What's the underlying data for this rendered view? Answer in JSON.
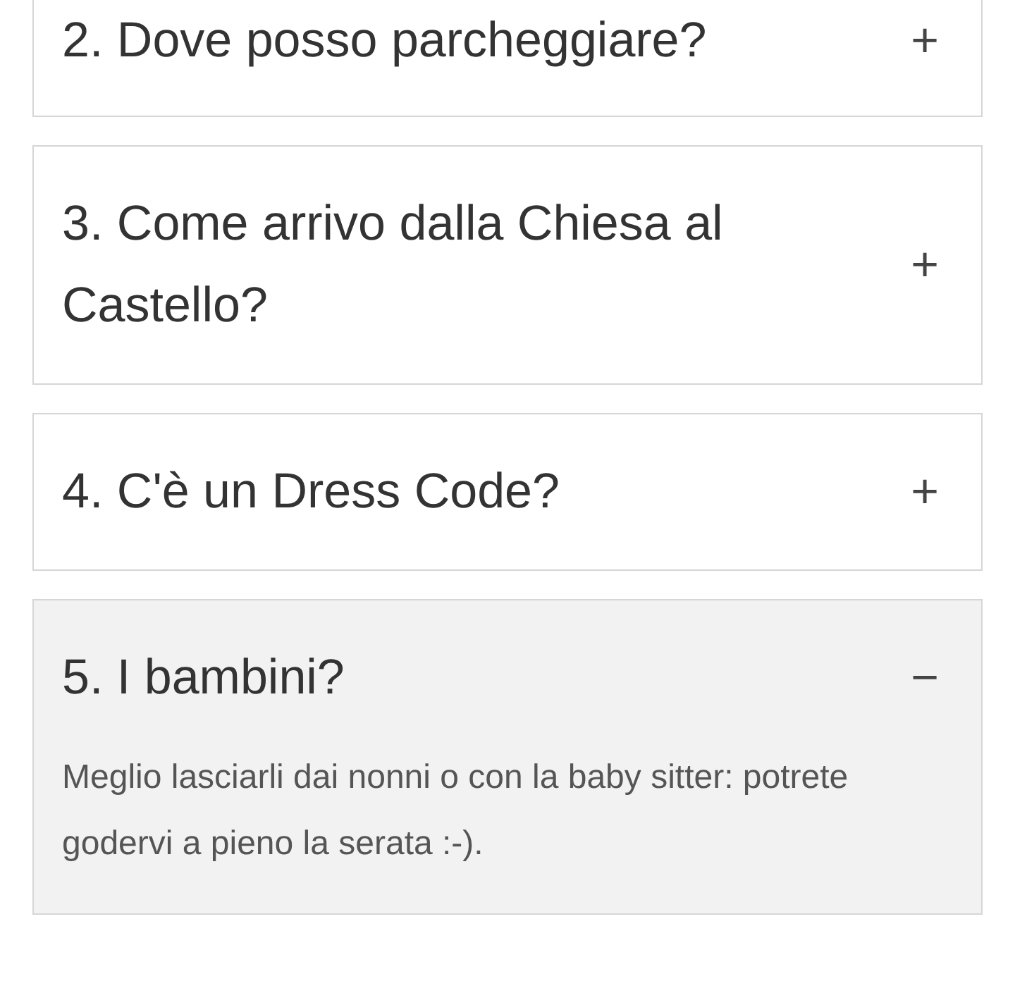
{
  "faq": [
    {
      "question": "2. Dove posso parcheggiare?",
      "icon": "+",
      "expanded": false
    },
    {
      "question": "3. Come arrivo dalla Chiesa al Castello?",
      "icon": "+",
      "expanded": false
    },
    {
      "question": "4. C'è un Dress Code?",
      "icon": "+",
      "expanded": false
    },
    {
      "question": "5. I bambini?",
      "icon": "−",
      "expanded": true,
      "answer": "Meglio lasciarli dai nonni o con la baby sitter: potrete godervi a pieno la serata :-)."
    }
  ]
}
